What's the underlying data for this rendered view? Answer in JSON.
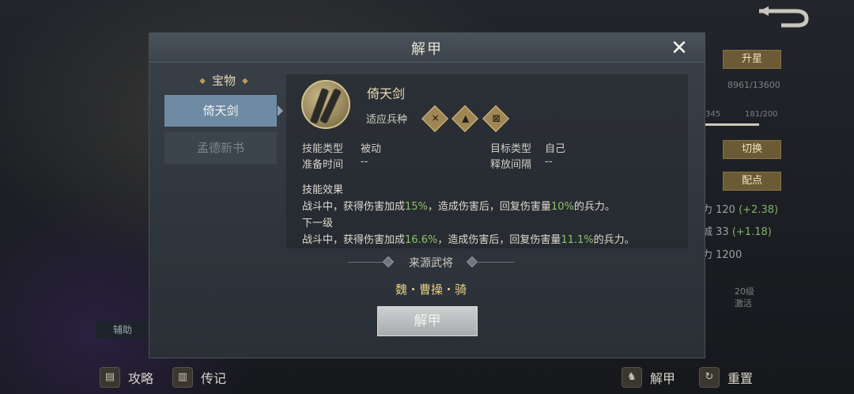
{
  "background": {
    "back_icon": "return-arrow-icon",
    "buttons": {
      "upgrade": "升星",
      "switch": "切换",
      "allocate": "配点"
    },
    "exp_text": "8961/13600",
    "level_left": "345",
    "level_right": "181/200",
    "stats": [
      {
        "label": "力 120",
        "bonus": "(+2.38)"
      },
      {
        "label": "城 33",
        "bonus": "(+1.18)"
      },
      {
        "label": "力 1200",
        "bonus": ""
      }
    ],
    "unlock_level": "20级",
    "unlock_label": "激活",
    "side_badge": "辅助",
    "bottom_left": [
      {
        "icon": "strategy-book-icon",
        "label": "攻略"
      },
      {
        "icon": "biography-book-icon",
        "label": "传记"
      }
    ],
    "bottom_right": [
      {
        "icon": "unequip-figure-icon",
        "label": "解甲"
      },
      {
        "icon": "reset-swirl-icon",
        "label": "重置"
      }
    ]
  },
  "modal": {
    "title": "解甲",
    "category": "宝物",
    "tabs": [
      {
        "label": "倚天剑",
        "active": true
      },
      {
        "label": "孟德新书",
        "active": false
      }
    ],
    "item": {
      "name": "倚天剑",
      "icon": "twin-sword-icon",
      "adapt_label": "适应兵种",
      "unit_icons": [
        "crossed-swords-icon",
        "arrow-up-icon",
        "shield-cross-icon"
      ]
    },
    "details": {
      "skill_type_label": "技能类型",
      "skill_type_value": "被动",
      "target_type_label": "目标类型",
      "target_type_value": "自己",
      "prep_time_label": "准备时间",
      "prep_time_value": "--",
      "interval_label": "释放间隔",
      "interval_value": "--"
    },
    "effect": {
      "heading": "技能效果",
      "current": {
        "pre": "战斗中，获得伤害加成",
        "pct1": "15%",
        "mid": "，造成伤害后，回复伤害量",
        "pct2": "10%",
        "post": "的兵力。"
      },
      "next_heading": "下一级",
      "next": {
        "pre": "战斗中，获得伤害加成",
        "pct1": "16.6%",
        "mid": "，造成伤害后，回复伤害量",
        "pct2": "11.1%",
        "post": "的兵力。"
      }
    },
    "source_title": "来源武将",
    "source_general": "魏・曹操・骑",
    "action_button": "解甲",
    "colors": {
      "highlight": "#8fc06a",
      "gold": "#e8cf86",
      "tab_active": "#6f8aa3"
    }
  }
}
